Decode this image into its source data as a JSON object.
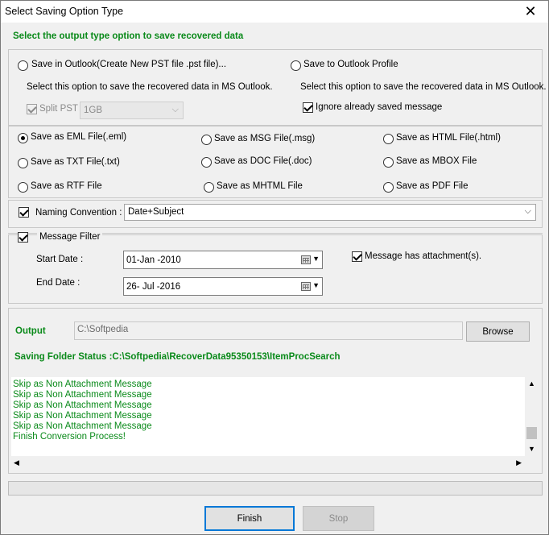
{
  "window": {
    "title": "Select Saving Option Type",
    "close_glyph": "✕"
  },
  "header": {
    "instruction": "Select the output type option to save recovered data"
  },
  "outlook": {
    "pst_label": "Save in Outlook(Create New PST file .pst file)...",
    "pst_desc": "Select this option to save the recovered data in MS Outlook.",
    "split_label": "Split PST",
    "split_value": "1GB",
    "profile_label": "Save to Outlook Profile",
    "profile_desc": "Select this option to save the recovered data in MS Outlook.",
    "ignore_label": "Ignore already saved message"
  },
  "formats": [
    {
      "label": "Save as EML File(.eml)",
      "selected": true
    },
    {
      "label": "Save as MSG File(.msg)",
      "selected": false
    },
    {
      "label": "Save as HTML File(.html)",
      "selected": false
    },
    {
      "label": "Save as TXT File(.txt)",
      "selected": false
    },
    {
      "label": "Save as DOC File(.doc)",
      "selected": false
    },
    {
      "label": "Save as MBOX File",
      "selected": false
    },
    {
      "label": "Save as RTF File",
      "selected": false
    },
    {
      "label": "Save as MHTML File",
      "selected": false
    },
    {
      "label": "Save as PDF File",
      "selected": false
    }
  ],
  "naming": {
    "label": "Naming Convention :",
    "value": "Date+Subject",
    "checked": true
  },
  "filter": {
    "label": "Message Filter",
    "checked": true,
    "start_label": "Start Date :",
    "start_value": "01-Jan -2010",
    "end_label": "End Date :",
    "end_value": "26- Jul -2016",
    "attachment_label": "Message has attachment(s).",
    "attachment_checked": true
  },
  "output": {
    "label": "Output",
    "path": "C:\\Softpedia",
    "browse_label": "Browse",
    "status": "Saving Folder Status :C:\\Softpedia\\RecoverData95350153\\ItemProcSearch"
  },
  "log": [
    "Skip as Non Attachment Message",
    "Skip as Non Attachment Message",
    "Skip as Non Attachment Message",
    "Skip as Non Attachment Message",
    "Skip as Non Attachment Message",
    "Finish Conversion Process!"
  ],
  "buttons": {
    "finish": "Finish",
    "stop": "Stop"
  },
  "colors": {
    "accent_green": "#0a8a1a",
    "focus_blue": "#0078d7"
  }
}
